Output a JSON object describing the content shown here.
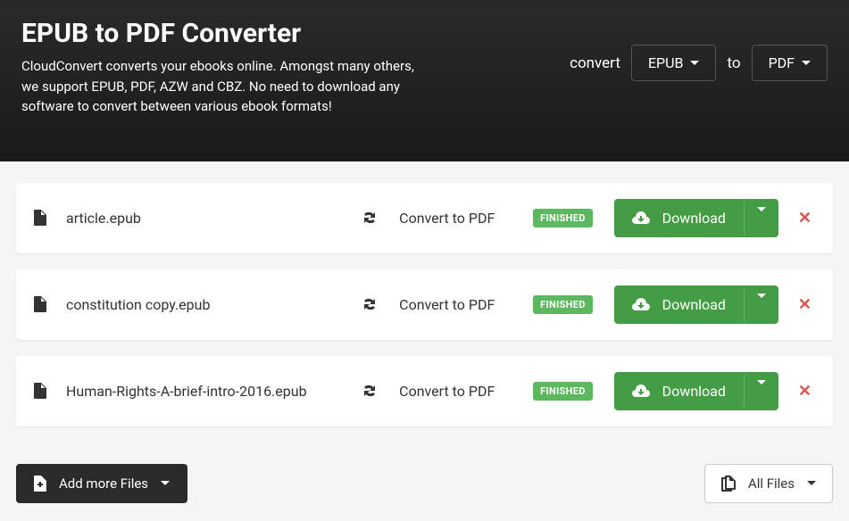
{
  "header": {
    "title": "EPUB to PDF Converter",
    "description": "CloudConvert converts your ebooks online. Amongst many others, we support EPUB, PDF, AZW and CBZ. No need to download any software to convert between various ebook formats!",
    "convert_label": "convert",
    "to_label": "to",
    "from_format": "EPUB",
    "to_format": "PDF"
  },
  "files": [
    {
      "name": "article.epub",
      "action": "Convert to PDF",
      "status": "FINISHED",
      "download_label": "Download"
    },
    {
      "name": "constitution copy.epub",
      "action": "Convert to PDF",
      "status": "FINISHED",
      "download_label": "Download"
    },
    {
      "name": "Human-Rights-A-brief-intro-2016.epub",
      "action": "Convert to PDF",
      "status": "FINISHED",
      "download_label": "Download"
    }
  ],
  "buttons": {
    "add_more": "Add more Files",
    "all_files": "All Files"
  }
}
